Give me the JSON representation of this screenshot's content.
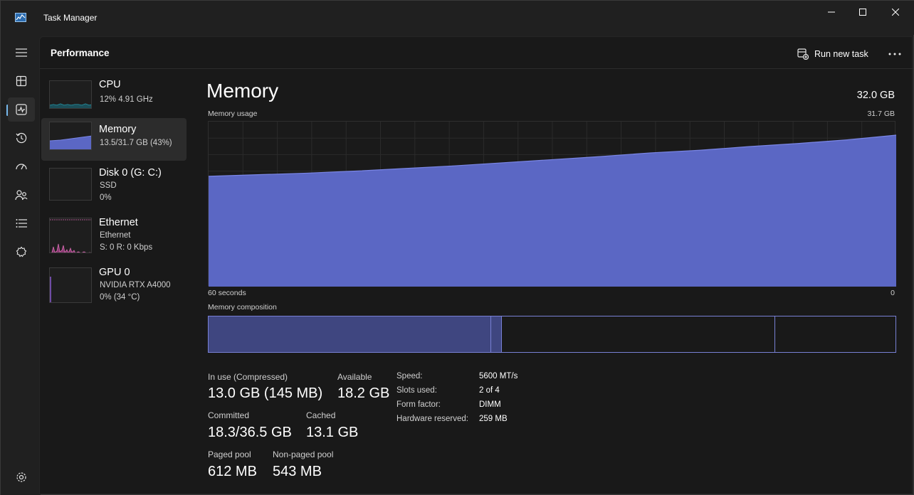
{
  "window": {
    "title": "Task Manager"
  },
  "header": {
    "title": "Performance",
    "run_new_task": "Run new task"
  },
  "nav": {
    "items": [
      {
        "name": "hamburger-menu-icon"
      },
      {
        "name": "processes-icon"
      },
      {
        "name": "performance-icon",
        "active": true
      },
      {
        "name": "app-history-icon"
      },
      {
        "name": "startup-apps-icon"
      },
      {
        "name": "users-icon"
      },
      {
        "name": "details-icon"
      },
      {
        "name": "services-icon"
      },
      {
        "name": "settings-icon"
      }
    ]
  },
  "devices": [
    {
      "name": "CPU",
      "line1": "12%  4.91 GHz",
      "line2": ""
    },
    {
      "name": "Memory",
      "line1": "13.5/31.7 GB (43%)",
      "line2": "",
      "selected": true
    },
    {
      "name": "Disk 0 (G: C:)",
      "line1": "SSD",
      "line2": "0%"
    },
    {
      "name": "Ethernet",
      "line1": "Ethernet",
      "line2": "S: 0  R: 0 Kbps"
    },
    {
      "name": "GPU 0",
      "line1": "NVIDIA RTX A4000",
      "line2": "0%  (34 °C)"
    }
  ],
  "memory": {
    "title": "Memory",
    "total": "32.0 GB",
    "usage_label": "Memory usage",
    "usage_max": "31.7 GB",
    "time_left": "60 seconds",
    "time_right": "0",
    "composition_label": "Memory composition",
    "usage_series_gb": [
      21.2,
      21.5,
      21.8,
      22.2,
      22.7,
      23.2,
      23.8,
      24.4,
      25.0,
      25.7,
      26.2,
      26.9,
      27.5,
      28.2,
      29.1
    ],
    "usage_max_gb": 31.7,
    "composition_gb": {
      "in_use": 13.0,
      "modified": 0.5,
      "standby": 12.6,
      "free": 5.6,
      "total": 31.7
    },
    "stats": {
      "in_use_label": "In use (Compressed)",
      "in_use_value": "13.0 GB (145 MB)",
      "available_label": "Available",
      "available_value": "18.2 GB",
      "committed_label": "Committed",
      "committed_value": "18.3/36.5 GB",
      "cached_label": "Cached",
      "cached_value": "13.1 GB",
      "paged_label": "Paged pool",
      "paged_value": "612 MB",
      "nonpaged_label": "Non-paged pool",
      "nonpaged_value": "543 MB"
    },
    "details": [
      {
        "label": "Speed:",
        "value": "5600 MT/s"
      },
      {
        "label": "Slots used:",
        "value": "2 of 4"
      },
      {
        "label": "Form factor:",
        "value": "DIMM"
      },
      {
        "label": "Hardware reserved:",
        "value": "259 MB"
      }
    ]
  },
  "colors": {
    "memory_fill": "#5b67c4",
    "memory_line": "#7a86e6",
    "cpu": "#2aa3b5",
    "ethernet": "#d46bb0",
    "gpu": "#8a5bd0",
    "accent": "#76b9ed"
  }
}
